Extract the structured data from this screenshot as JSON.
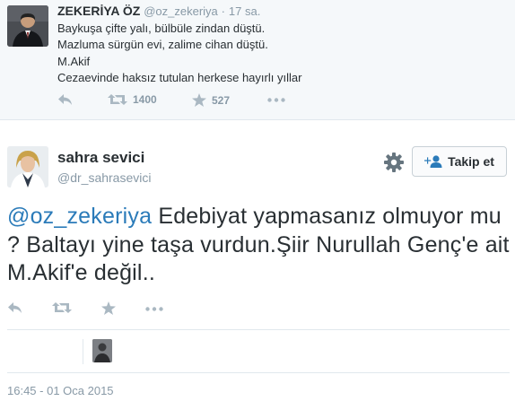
{
  "quoted_tweet": {
    "author_name": "ZEKERİYA ÖZ",
    "author_handle": "@oz_zekeriya",
    "separator": "·",
    "time_ago": "17 sa.",
    "lines": [
      "Baykuşa çifte yalı, bülbüle zindan düştü.",
      "Mazluma sürgün evi, zalime cihan düştü.",
      "M.Akif",
      "Cezaevinde haksız tutulan herkese hayırlı yıllar"
    ],
    "actions": {
      "reply_icon": "reply-icon",
      "retweet_icon": "retweet-icon",
      "retweet_count": "1400",
      "favorite_icon": "star-icon",
      "favorite_count": "527",
      "more_icon": "more-dots-icon"
    }
  },
  "main_tweet": {
    "author_name": "sahra sevici",
    "author_handle": "@dr_sahrasevici",
    "follow_label": "Takip et",
    "mention": "@oz_zekeriya",
    "body": " Edebiyat yapmasanız olmuyor mu ? Baltayı yine taşa vurdun.Şiir Nurullah Genç'e ait M.Akif'e değil..",
    "timestamp": "16:45 - 01 Oca 2015"
  },
  "colors": {
    "accent": "#2b7bb9",
    "muted": "#8899a6",
    "text": "#292f33",
    "icon": "#aab8c2"
  }
}
